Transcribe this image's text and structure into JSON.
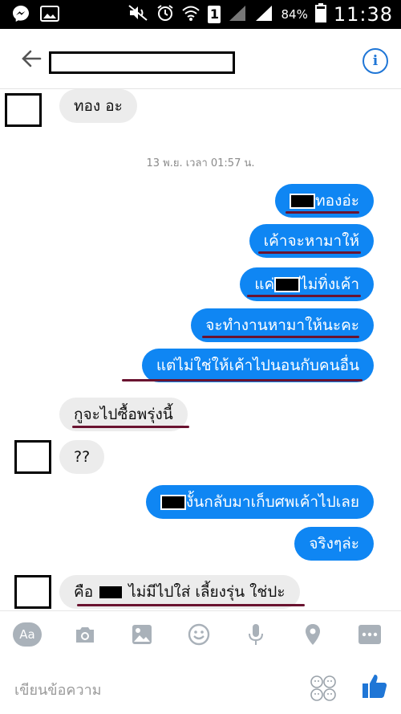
{
  "statusbar": {
    "battery": "84%",
    "time": "11:38",
    "sim_badge": "1"
  },
  "header": {
    "title_redacted": true
  },
  "timestamp": "13 พ.ย. เวลา 01:57 น.",
  "messages_in": [
    {
      "id": "in1",
      "text": "ทอง อะ"
    },
    {
      "id": "in2",
      "text": "กูจะไปซื้อพรุ่งนี้"
    },
    {
      "id": "in3",
      "text": "??"
    },
    {
      "id": "in4",
      "pre": "คือ",
      "post": " ไม่มีไปใส่ เลี้ยงรุ่น ใช่ปะ"
    }
  ],
  "messages_out": [
    {
      "id": "out1",
      "pre": "",
      "post": "ทองอ่ะ"
    },
    {
      "id": "out2",
      "text": "เค้าจะหามาให้"
    },
    {
      "id": "out3",
      "pre": "แค่",
      "post": "ไม่ทิ่งเค้า"
    },
    {
      "id": "out4",
      "text": "จะทำงานหามาให้นะคะ"
    },
    {
      "id": "out5",
      "text": "แต่ไม่ใช่ให้เค้าไปนอนกับคนอื่น"
    },
    {
      "id": "out6",
      "pre": "",
      "post": "งั้นกลับมาเก็บศพเค้าไปเลย"
    },
    {
      "id": "out7",
      "text": "จริงๆล่ะ"
    }
  ],
  "toolbar": {
    "aa_label": "Aa",
    "icons": [
      "camera-icon",
      "gallery-icon",
      "emoji-icon",
      "microphone-icon",
      "location-icon",
      "more-icon"
    ]
  },
  "composer": {
    "placeholder": "เขียนข้อความ"
  },
  "colors": {
    "outgoing": "#0f86f3",
    "incoming": "#ececec",
    "underline": "#6a1330",
    "accent": "#1f76d6"
  }
}
